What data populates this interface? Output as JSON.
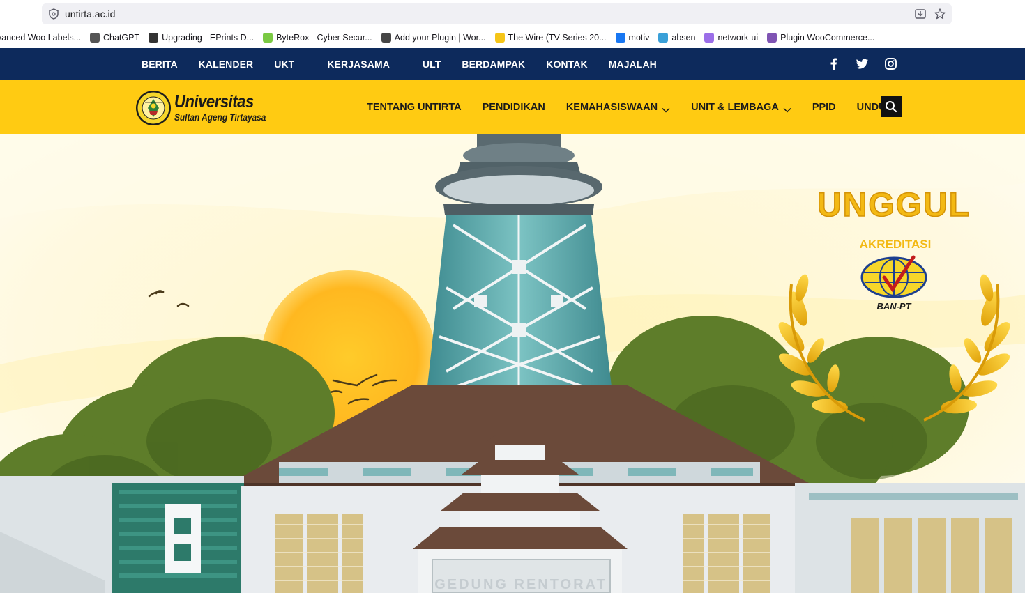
{
  "browser": {
    "url": "untirta.ac.id",
    "bookmarks": [
      {
        "label": "vanced Woo Labels...",
        "color": "#ffffff"
      },
      {
        "label": "ChatGPT",
        "color": "#555555"
      },
      {
        "label": "Upgrading - EPrints D...",
        "color": "#333333"
      },
      {
        "label": "ByteRox - Cyber Secur...",
        "color": "#7ac943"
      },
      {
        "label": "Add your Plugin | Wor...",
        "color": "#464646"
      },
      {
        "label": "The Wire (TV Series 20...",
        "color": "#f5c518"
      },
      {
        "label": "motiv",
        "color": "#1877f2"
      },
      {
        "label": "absen",
        "color": "#3aa0d8"
      },
      {
        "label": "network-ui",
        "color": "#9b6ee8"
      },
      {
        "label": "Plugin WooCommerce...",
        "color": "#7f54b3"
      }
    ]
  },
  "topnav": {
    "links": [
      "BERITA",
      "KALENDER",
      "UKT",
      "KERJASAMA",
      "ULT",
      "BERDAMPAK",
      "KONTAK",
      "MAJALAH"
    ],
    "social": [
      "facebook-icon",
      "twitter-icon",
      "instagram-icon"
    ]
  },
  "mainnav": {
    "logo_title": "Universitas",
    "logo_subtitle": "Sultan Ageng Tirtayasa",
    "items": [
      {
        "label": "TENTANG UNTIRTA",
        "dropdown": false
      },
      {
        "label": "PENDIDIKAN",
        "dropdown": false
      },
      {
        "label": "KEMAHASISWAAN",
        "dropdown": true
      },
      {
        "label": "UNIT & LEMBAGA",
        "dropdown": true
      },
      {
        "label": "PPID",
        "dropdown": false
      },
      {
        "label": "UNDUH",
        "dropdown": false
      }
    ]
  },
  "hero": {
    "badge_title": "UNGGUL",
    "badge_subtitle": "AKREDITASI",
    "badge_org": "BAN-PT",
    "building_sign": "GEDUNG RENTORAT",
    "colors": {
      "sky": "#fff6c8",
      "sun": "#ffb81c",
      "building": "#e9ecef",
      "roof": "#6b4a3a",
      "glass": "#5aa6a8"
    }
  },
  "colors": {
    "topnav": "#0d2a5c",
    "mainnav": "#ffcb12"
  }
}
